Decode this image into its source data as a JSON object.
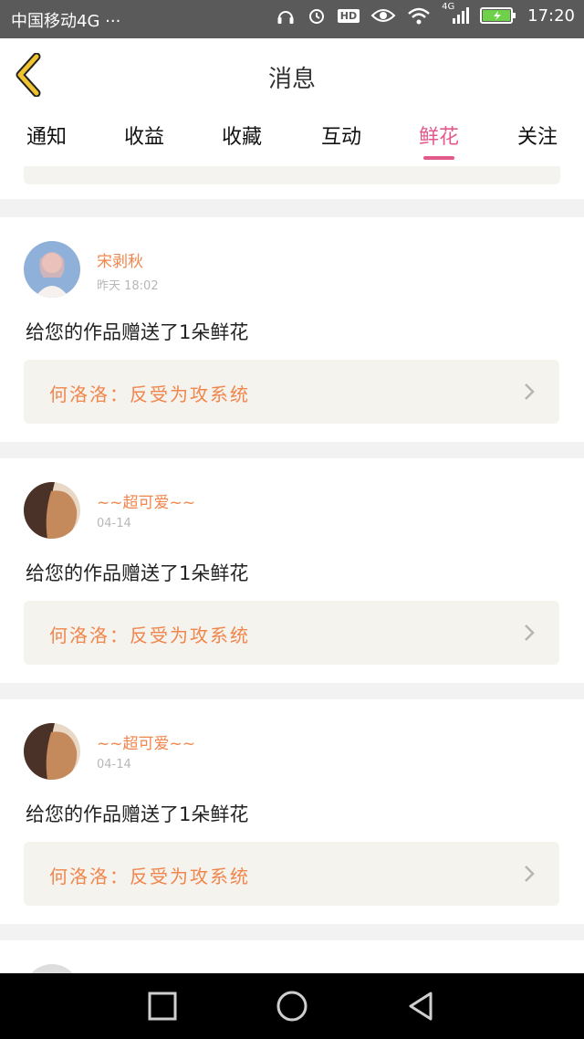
{
  "status_bar": {
    "carrier": "中国移动4G ···",
    "network": "4G",
    "hd": "HD",
    "time": "17:20"
  },
  "header": {
    "title": "消息"
  },
  "tabs": [
    {
      "label": "通知"
    },
    {
      "label": "收益"
    },
    {
      "label": "收藏"
    },
    {
      "label": "互动"
    },
    {
      "label": "鲜花"
    },
    {
      "label": "关注"
    }
  ],
  "active_tab": "鲜花",
  "messages": [
    {
      "user": "宋剥秋",
      "time": "昨天 18:02",
      "text": "给您的作品赠送了1朵鲜花",
      "work": "何洛洛：反受为攻系统"
    },
    {
      "user": "~~超可爱~~",
      "time": "04-14",
      "text": "给您的作品赠送了1朵鲜花",
      "work": "何洛洛：反受为攻系统"
    },
    {
      "user": "~~超可爱~~",
      "time": "04-14",
      "text": "给您的作品赠送了1朵鲜花",
      "work": "何洛洛：反受为攻系统"
    }
  ],
  "colors": {
    "accent": "#e25a8c",
    "username": "#f0864c",
    "status_bar": "#5a5a5a",
    "back_icon": "#f0c430",
    "work_box": "#f4f3ee"
  },
  "icons": [
    "headphones-icon",
    "alarm-icon",
    "hd-icon",
    "eye-icon",
    "wifi-icon",
    "signal-icon",
    "battery-icon",
    "back-chevron-icon",
    "chevron-right-icon",
    "nav-square-icon",
    "nav-circle-icon",
    "nav-back-icon"
  ]
}
